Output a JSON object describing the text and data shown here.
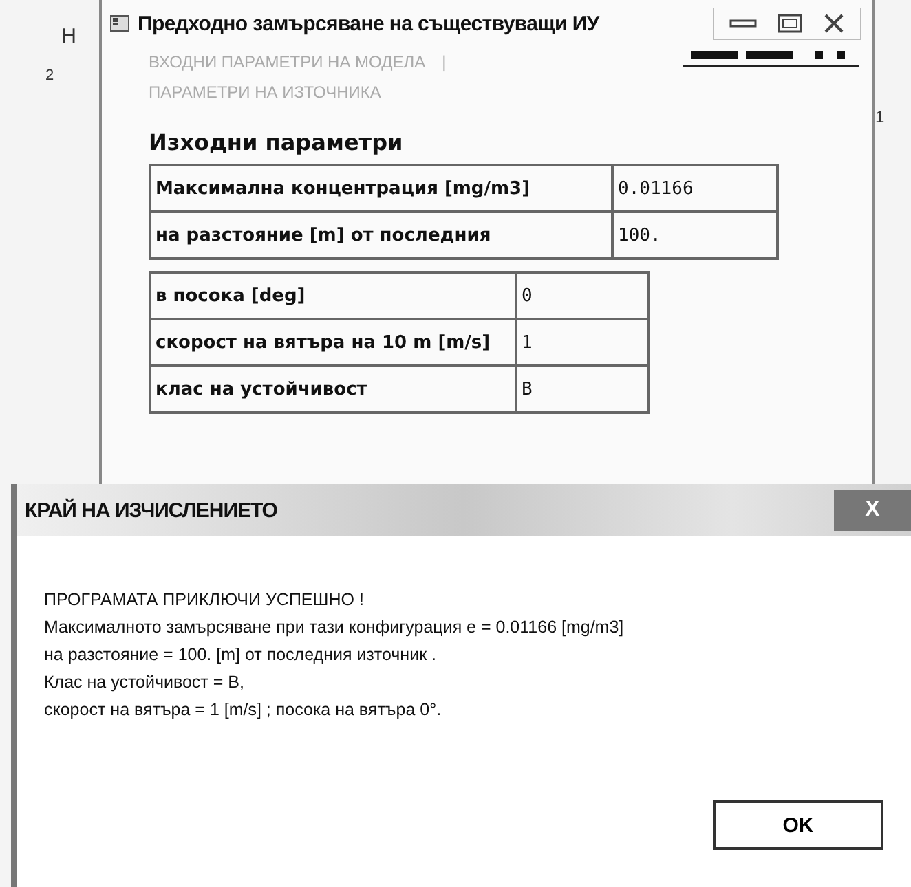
{
  "edge_marks": {
    "left_top": "Н",
    "left_middle": "2",
    "right_middle": "1"
  },
  "window": {
    "title": "Предходно замърсяване на съществуващи ИУ"
  },
  "tabs": [
    {
      "label": "ВХОДНИ ПАРАМЕТРИ НА МОДЕЛА",
      "separator": "|"
    },
    {
      "label": "ПАРАМЕТРИ НА ИЗТОЧНИКА"
    }
  ],
  "section_title": "Изходни параметри",
  "result_table": [
    {
      "label": "Максимална концентрация  [mg/m3]",
      "value": "0.01166"
    },
    {
      "label": "на разстояние [m] от последния",
      "value": "100."
    }
  ],
  "condition_table": [
    {
      "label": "в посока [deg]",
      "value": "0"
    },
    {
      "label": "скорост на вятъра на 10 m [m/s]",
      "value": "1"
    },
    {
      "label": "клас на устойчивост",
      "value": "B"
    }
  ],
  "dialog": {
    "title": "КРАЙ НА ИЗЧИСЛЕНИЕТО",
    "close": "X",
    "lines": [
      "ПРОГРАМАТА ПРИКЛЮЧИ УСПЕШНО  !",
      "Максималното замърсяване при тази конфигурация е = 0.01166 [mg/m3]",
      "на разстояние = 100. [m]  от последния източник  .",
      "Клас на устойчивост = B,",
      "скорост на вятъра = 1 [m/s]  ;  посока на вятъра  0°."
    ],
    "button": "OK"
  }
}
